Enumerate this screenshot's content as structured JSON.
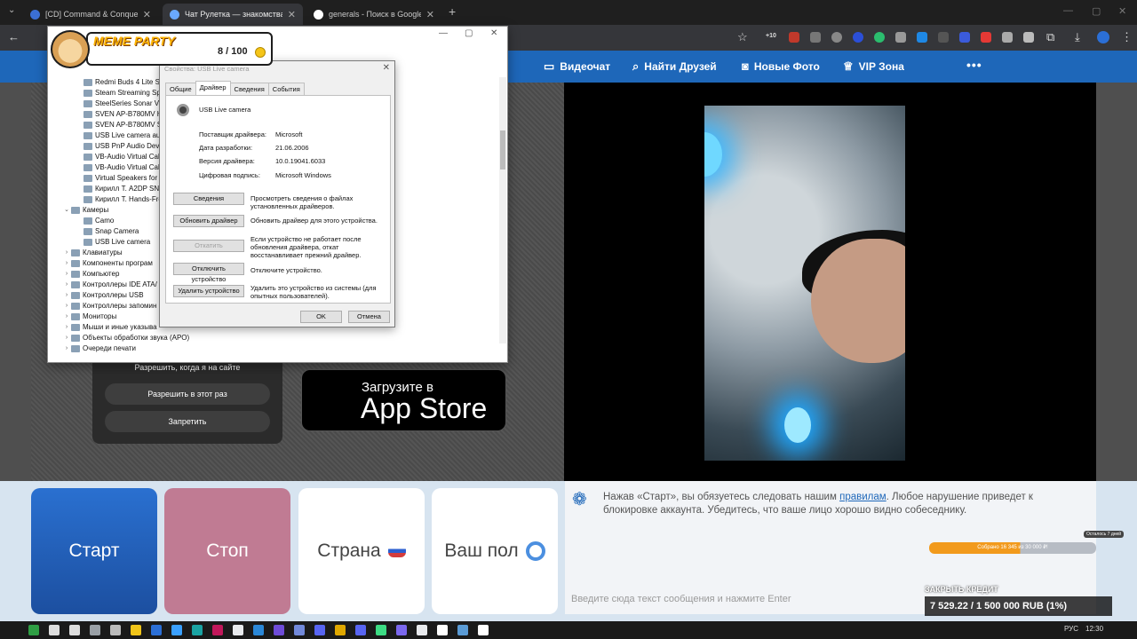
{
  "browser": {
    "tabs": [
      {
        "title": "[CD] Command & Conquer: Ge",
        "active": false,
        "color": "#3b6fd4"
      },
      {
        "title": "Чат Рулетка — знакомства и о",
        "active": true,
        "color": "#6aa9ff"
      },
      {
        "title": "generals - Поиск в Google",
        "active": false,
        "color": "#ffffff"
      }
    ],
    "new_tab": "+",
    "ext_badge": "+10"
  },
  "nav": {
    "items": [
      {
        "label": "Видеочат",
        "icon": "video-icon"
      },
      {
        "label": "Найти Друзей",
        "icon": "search-icon"
      },
      {
        "label": "Новые Фото",
        "icon": "camera-icon"
      },
      {
        "label": "VIP Зона",
        "icon": "crown-icon"
      }
    ],
    "more": "•••"
  },
  "meme_party": {
    "logo": "MEME PARTY",
    "count": "8 / 100"
  },
  "device_manager": {
    "tree": [
      {
        "label": "Redmi Buds 4 Lite St",
        "level": 2
      },
      {
        "label": "Steam Streaming Sp",
        "level": 2
      },
      {
        "label": "SteelSeries Sonar Virt",
        "level": 2
      },
      {
        "label": "SVEN AP-B780MV H",
        "level": 2
      },
      {
        "label": "SVEN AP-B780MV St",
        "level": 2
      },
      {
        "label": "USB Live camera auc",
        "level": 2
      },
      {
        "label": "USB PnP Audio Devi",
        "level": 2
      },
      {
        "label": "VB-Audio Virtual Cal",
        "level": 2
      },
      {
        "label": "VB-Audio Virtual Cal",
        "level": 2
      },
      {
        "label": "Virtual Speakers for A",
        "level": 2
      },
      {
        "label": "Кирилл Т. A2DP SNI",
        "level": 2
      },
      {
        "label": "Кирилл Т. Hands-Fre",
        "level": 2
      },
      {
        "label": "Камеры",
        "level": 1,
        "expanded": true
      },
      {
        "label": "Camo",
        "level": 2
      },
      {
        "label": "Snap Camera",
        "level": 2
      },
      {
        "label": "USB Live camera",
        "level": 2
      },
      {
        "label": "Клавиатуры",
        "level": 1
      },
      {
        "label": "Компоненты програм",
        "level": 1
      },
      {
        "label": "Компьютер",
        "level": 1
      },
      {
        "label": "Контроллеры IDE ATA/",
        "level": 1
      },
      {
        "label": "Контроллеры USB",
        "level": 1
      },
      {
        "label": "Контроллеры запомин",
        "level": 1
      },
      {
        "label": "Мониторы",
        "level": 1
      },
      {
        "label": "Мыши и иные указыва",
        "level": 1
      },
      {
        "label": "Объекты обработки звука (APO)",
        "level": 1
      },
      {
        "label": "Очереди печати",
        "level": 1
      }
    ]
  },
  "dialog": {
    "title": "Свойства: USB Live camera",
    "tabs": [
      "Общие",
      "Драйвер",
      "Сведения",
      "События"
    ],
    "device_name": "USB Live camera",
    "fields": [
      {
        "key": "Поставщик драйвера:",
        "value": "Microsoft"
      },
      {
        "key": "Дата разработки:",
        "value": "21.06.2006"
      },
      {
        "key": "Версия драйвера:",
        "value": "10.0.19041.6033"
      },
      {
        "key": "Цифровая подпись:",
        "value": "Microsoft Windows"
      }
    ],
    "actions": [
      {
        "button": "Сведения",
        "desc": "Просмотреть сведения о файлах установленных драйверов.",
        "disabled": false
      },
      {
        "button": "Обновить драйвер",
        "desc": "Обновить драйвер для этого устройства.",
        "disabled": false
      },
      {
        "button": "Откатить",
        "desc": "Если устройство не работает после обновления драйвера, откат восстанавливает прежний драйвер.",
        "disabled": true
      },
      {
        "button": "Отключить устройство",
        "desc": "Отключите устройство.",
        "disabled": false
      },
      {
        "button": "Удалить устройство",
        "desc": "Удалить это устройство из системы (для опытных пользователей).",
        "disabled": false
      }
    ],
    "ok": "OK",
    "cancel": "Отмена"
  },
  "permission": {
    "buttons": [
      "Разрешить, когда я на сайте",
      "Разрешить в этот раз",
      "Запретить"
    ]
  },
  "appstore": {
    "small": "Загрузите в",
    "big": "App Store"
  },
  "controls": {
    "start": "Старт",
    "stop": "Стоп",
    "country": "Страна",
    "gender": "Ваш пол"
  },
  "chat": {
    "message_before": "Нажав «Старт», вы обязуетесь следовать нашим ",
    "message_link": "правилам",
    "message_after": ". Любое нарушение приведет к блокировке аккаунта. Убедитесь, что ваше лицо хорошо видно собеседнику.",
    "input_placeholder": "Введите сюда текст сообщения и нажмите Enter"
  },
  "credit": {
    "bar_text": "Собрано 16 345 из 30 000 ₽!",
    "tag": "Осталось 7 дней",
    "progress": 0.545,
    "label": "ЗАКРЫТЬ КРЕДИТ",
    "amount": "7 529.22 / 1 500 000 RUB (1%)"
  },
  "taskbar": {
    "lang": "РУС",
    "time": "12:30"
  },
  "colors": {
    "nav": "#1e67b9",
    "start": "#2a70d0",
    "stop": "#c07b93"
  }
}
